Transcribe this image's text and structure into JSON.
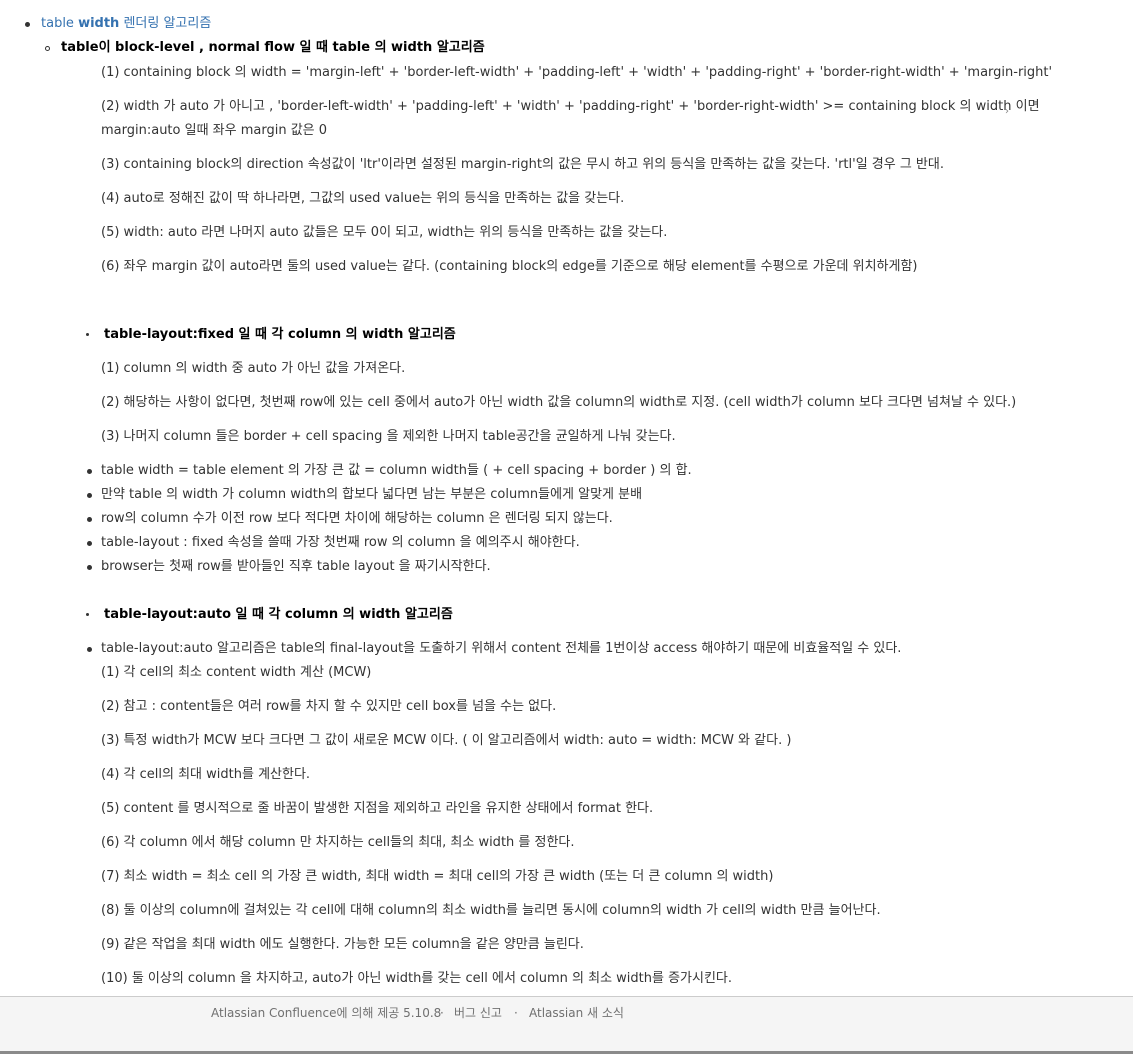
{
  "heading": {
    "link_prefix": "table ",
    "link_bold": "width",
    "link_suffix": " 렌더링 알고리즘"
  },
  "section_block": {
    "title": "table이 block-level , normal flow 일 때 table 의 width 알고리즘",
    "items": [
      "(1) containing block 의 width = 'margin-left' + 'border-left-width' + 'padding-left' + 'width' + 'padding-right' + 'border-right-width' + 'margin-right'",
      "(2) width 가 auto 가 아니고 , 'border-left-width' + 'padding-left' + 'width' + 'padding-right' + 'border-right-width'  >=  containing block 의 width 이면",
      "margin:auto 일때 좌우 margin 값은 0",
      "(3) containing block의 direction 속성값이 'ltr'이라면 설정된 margin-right의 값은 무시 하고 위의 등식을 만족하는 값을 갖는다. 'rtl'일 경우 그 반대.",
      "(4) auto로 정해진 값이 딱 하나라면, 그값의 used value는 위의 등식을 만족하는 값을 갖는다.",
      "(5) width: auto 라면 나머지 auto 값들은 모두 0이 되고, width는 위의 등식을 만족하는 값을 갖는다.",
      "(6) 좌우 margin 값이 auto라면 둘의 used value는 같다. (containing block의 edge를 기준으로 해당 element를 수평으로 가운데 위치하게함)"
    ]
  },
  "section_fixed": {
    "title": "table-layout:fixed 일 때 각 column 의 width 알고리즘",
    "items": [
      "(1) column 의 width 중 auto 가 아닌 값을 가져온다.",
      "(2) 해당하는 사항이 없다면, 첫번째 row에 있는 cell 중에서 auto가 아닌 width 값을 column의 width로 지정. (cell width가 column 보다 크다면 넘쳐날 수 있다.)",
      "(3) 나머지 column 들은 border + cell spacing 을 제외한 나머지 table공간을 균일하게 나눠 갖는다."
    ],
    "bullets": [
      "table width = table element 의 가장 큰 값 = column width들 ( + cell spacing + border ) 의 합.",
      "만약 table 의 width 가 column width의 합보다 넓다면 남는 부분은 column들에게 알맞게 분배",
      "row의 column 수가 이전 row 보다 적다면 차이에 해당하는 column 은 렌더링 되지 않는다.",
      "table-layout : fixed 속성을 쓸때 가장 첫번째 row 의 column 을 예의주시 해야한다.",
      "browser는 첫째 row를 받아들인 직후 table layout 을 짜기시작한다."
    ]
  },
  "section_auto": {
    "title": "table-layout:auto 일 때 각 column 의 width 알고리즘",
    "bullet": "table-layout:auto 알고리즘은 table의 final-layout을 도출하기 위해서 content 전체를 1번이상 access 해야하기 때문에 비효율적일 수 있다.",
    "items": [
      "(1) 각 cell의 최소 content width 계산 (MCW)",
      "(2) 참고 : content들은 여러 row를 차지 할 수 있지만 cell box를 넘을 수는 없다.",
      "(3) 특정 width가 MCW 보다 크다면 그 값이 새로운 MCW 이다. ( 이 알고리즘에서 width: auto = width: MCW 와 같다. )",
      "(4) 각 cell의 최대 width를 계산한다.",
      "(5) content 를 명시적으로 줄 바꿈이 발생한 지점을 제외하고 라인을 유지한 상태에서 format 한다.",
      "(6) 각 column 에서 해당 column 만 차지하는 cell들의 최대, 최소 width 를 정한다.",
      "(7) 최소 width = 최소 cell 의 가장 큰 width, 최대 width = 최대 cell의 가장 큰 width (또는 더 큰 column 의 width)",
      "(8) 둘 이상의 column에 걸쳐있는 각 cell에 대해 column의 최소 width를 늘리면 동시에 column의 width 가 cell의 width 만큼 늘어난다.",
      "(9) 같은 작업을 최대 width 에도 실행한다. 가능한 모든 column을 같은 양만큼 늘린다.",
      "(10) 둘 이상의 column 을 차지하고, auto가 아닌 width를 갖는 cell 에서 column 의 최소 width를 증가시킨다."
    ]
  },
  "footer": {
    "powered": "Atlassian Confluence에 의해 제공 5.10.8",
    "sep": "·",
    "bug": "버그 신고",
    "news": "Atlassian 새 소식"
  }
}
